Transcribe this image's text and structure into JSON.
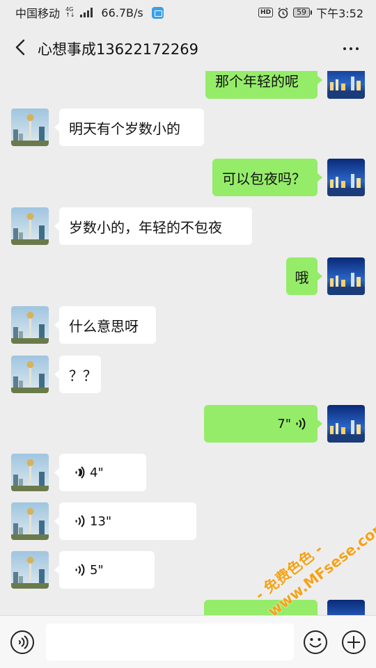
{
  "status_bar": {
    "carrier": "中国移动",
    "network": "4G",
    "speed": "66.7B/s",
    "hd": "HD",
    "battery": "59",
    "time": "下午3:52"
  },
  "header": {
    "title": "心想事成13622172269",
    "back_icon": "chevron-left-icon",
    "more_icon": "more-dots-icon"
  },
  "messages": [
    {
      "side": "out",
      "type": "text",
      "text": "那个年轻的呢"
    },
    {
      "side": "in",
      "type": "text",
      "text": "明天有个岁数小的"
    },
    {
      "side": "out",
      "type": "text",
      "text": "可以包夜吗？"
    },
    {
      "side": "in",
      "type": "text",
      "text": "岁数小的，年轻的不包夜"
    },
    {
      "side": "out",
      "type": "text",
      "text": "哦"
    },
    {
      "side": "in",
      "type": "text",
      "text": "什么意思呀"
    },
    {
      "side": "in",
      "type": "text",
      "text": "？？"
    },
    {
      "side": "out",
      "type": "voice",
      "text": "7\""
    },
    {
      "side": "in",
      "type": "voice",
      "text": "4\""
    },
    {
      "side": "in",
      "type": "voice",
      "text": "13\""
    },
    {
      "side": "in",
      "type": "voice",
      "text": "5\""
    }
  ],
  "input_bar": {
    "voice_icon": "voice-toggle-icon",
    "emoji_icon": "emoji-icon",
    "plus_icon": "plus-icon"
  },
  "watermark": {
    "line1": "- 免费色色 -",
    "line2": "www.MFsese.com"
  },
  "colors": {
    "outgoing_bubble": "#95ec69",
    "incoming_bubble": "#ffffff",
    "background": "#ededed",
    "watermark": "#f5a219"
  }
}
